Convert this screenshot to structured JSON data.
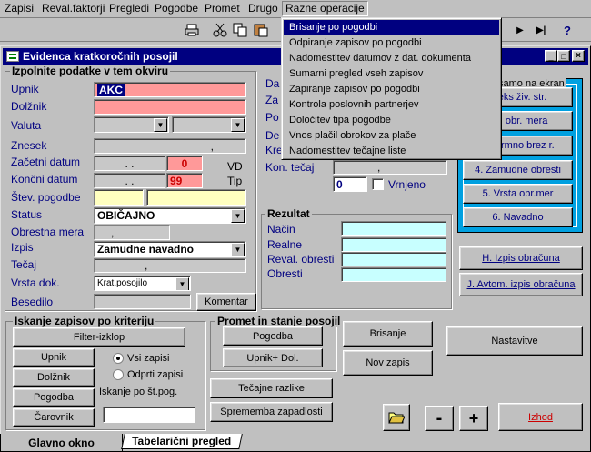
{
  "menubar": {
    "items": [
      "Zapisi",
      "Reval.faktorji",
      "Pregledi",
      "Pogodbe",
      "Promet",
      "Drugo",
      "Razne operacije"
    ]
  },
  "dropdown_menu": {
    "items": [
      "Brisanje po pogodbi",
      "Odpiranje zapisov po pogodbi",
      "Nadomestitev datumov z dat. dokumenta",
      "Sumarni pregled vseh zapisov",
      "Zapiranje zapisov po pogodbi",
      "Kontrola poslovnih partnerjev",
      "Določitev tipa pogodbe",
      "Vnos plačil obrokov za plače",
      "Nadomestitev tečajne liste"
    ],
    "selected": 0
  },
  "toolbar": {
    "icons": [
      "printer-icon",
      "cut-icon",
      "copy-icon",
      "paste-icon",
      "last-record-icon",
      "next-record-icon",
      "last-icon",
      "help-icon"
    ],
    "symbols": {
      "play": "▶",
      "last": "▶|",
      "help": "?"
    }
  },
  "window": {
    "title": "Evidenca kratkoročnih posojil",
    "controls": [
      "_",
      "□",
      "×"
    ]
  },
  "form_group": {
    "title": "Izpolnite podatke v tem okviru",
    "labels": {
      "upnik": "Upnik",
      "dolznik": "Dolžnik",
      "valuta": "Valuta",
      "znesek": "Znesek",
      "zacetni": "Začetni datum",
      "koncni": "Končni datum",
      "stev": "Štev. pogodbe",
      "status": "Status",
      "obrestna": "Obrestna mera",
      "izpis": "Izpis",
      "tecaj": "Tečaj",
      "vrsta": "Vrsta dok.",
      "besedilo": "Besedilo"
    },
    "values": {
      "upnik": "AKC",
      "znesek": ",",
      "zacetni": ". .",
      "zacetni_n": "0",
      "koncni": ". .",
      "koncni_n": "99",
      "status": "OBIČAJNO",
      "obrestna": ",",
      "izpis": "Zamudne navadno",
      "tecaj": ",",
      "vrsta": "Krat.posojilo"
    },
    "vd": "VD",
    "tip": "Tip",
    "komentar": "Komentar"
  },
  "mid": {
    "labels": [
      "Da",
      "Za",
      "Po",
      "De",
      "Kre"
    ],
    "kon_tecaj": "Kon. tečaj",
    "kon_val": ",",
    "zero": "0",
    "vrnjeno": "Vrnjeno"
  },
  "rezultat": {
    "title": "Rezultat",
    "labels": [
      "Način",
      "Realne",
      "Reval. obresti",
      "Obresti"
    ]
  },
  "right_panel": {
    "title": "samo na ekran",
    "buttons": [
      "deks živ. str.",
      "m. obr. mera",
      "informno brez r.",
      "4. Zamudne obresti",
      "5. Vrsta obr.mer",
      "6. Navadno"
    ],
    "izpis_obracuna": "H. Izpis obračuna",
    "avtom": "J. Avtom. izpis obračuna"
  },
  "iskanje": {
    "title": "Iskanje zapisov po kriteriju",
    "filter": "Filter-izklop",
    "buttons": [
      "Upnik",
      "Dolžnik",
      "Pogodba",
      "Čarovnik"
    ],
    "radio1": "Vsi zapisi",
    "radio2": "Odprti zapisi",
    "st_pog": "Iskanje po št.pog."
  },
  "promet": {
    "title": "Promet in stanje posojil",
    "pogodba": "Pogodba",
    "upnik_dol": "Upnik+ Dol."
  },
  "actions": {
    "brisanje": "Brisanje",
    "nov_zapis": "Nov zapis",
    "nastavitve": "Nastavitve",
    "tecajne": "Tečajne razlike",
    "sprememba": "Sprememba zapadlosti",
    "minus": "-",
    "plus": "+",
    "izhod": "Izhod"
  },
  "tabs": [
    "Glavno okno",
    "Tabelarični pregled"
  ],
  "colors": {
    "titlebar": "#000080",
    "menu_highlight": "#000080",
    "right_panel": "#00a0e0",
    "izhod_text": "#cc0000",
    "label": "#000080"
  }
}
